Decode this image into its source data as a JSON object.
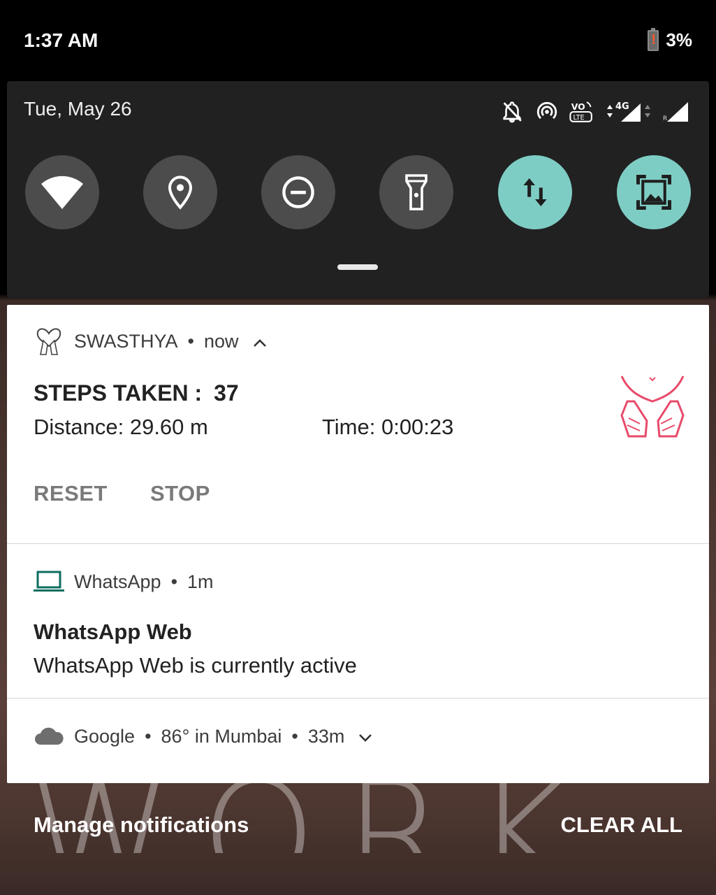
{
  "status_bar": {
    "time": "1:37 AM",
    "battery_text": "3%"
  },
  "quick_settings": {
    "date": "Tue, May 26",
    "status_icons": [
      "bell-off-icon",
      "hotspot-icon",
      "volte-icon",
      "4g-data-icon",
      "signal-icon-1",
      "roaming-signal-icon"
    ],
    "network_label": "4G",
    "tiles": [
      {
        "name": "wifi",
        "icon": "wifi-icon",
        "active": false
      },
      {
        "name": "location",
        "icon": "location-icon",
        "active": false
      },
      {
        "name": "dnd",
        "icon": "do-not-disturb-icon",
        "active": false
      },
      {
        "name": "flashlight",
        "icon": "flashlight-icon",
        "active": false
      },
      {
        "name": "mobile-data",
        "icon": "data-transfer-icon",
        "active": true
      },
      {
        "name": "screenshot",
        "icon": "screen-capture-icon",
        "active": true
      }
    ],
    "accent_color": "#7ecdc4"
  },
  "notifications": {
    "swasthya": {
      "app_name": "SWASTHYA",
      "sep": "•",
      "when": "now",
      "steps_label": "STEPS TAKEN :",
      "steps_value": "37",
      "distance": "Distance: 29.60 m",
      "time": "Time: 0:00:23",
      "actions": [
        "RESET",
        "STOP"
      ]
    },
    "whatsapp": {
      "app_name": "WhatsApp",
      "sep": "•",
      "when": "1m",
      "title": "WhatsApp Web",
      "text": "WhatsApp Web is currently active",
      "icon_color": "#0c6e5e"
    },
    "google": {
      "app_name": "Google",
      "sep": "•",
      "weather": "86° in Mumbai",
      "sep2": "•",
      "when": "33m"
    }
  },
  "footer": {
    "manage": "Manage notifications",
    "clear_all": "CLEAR ALL"
  }
}
